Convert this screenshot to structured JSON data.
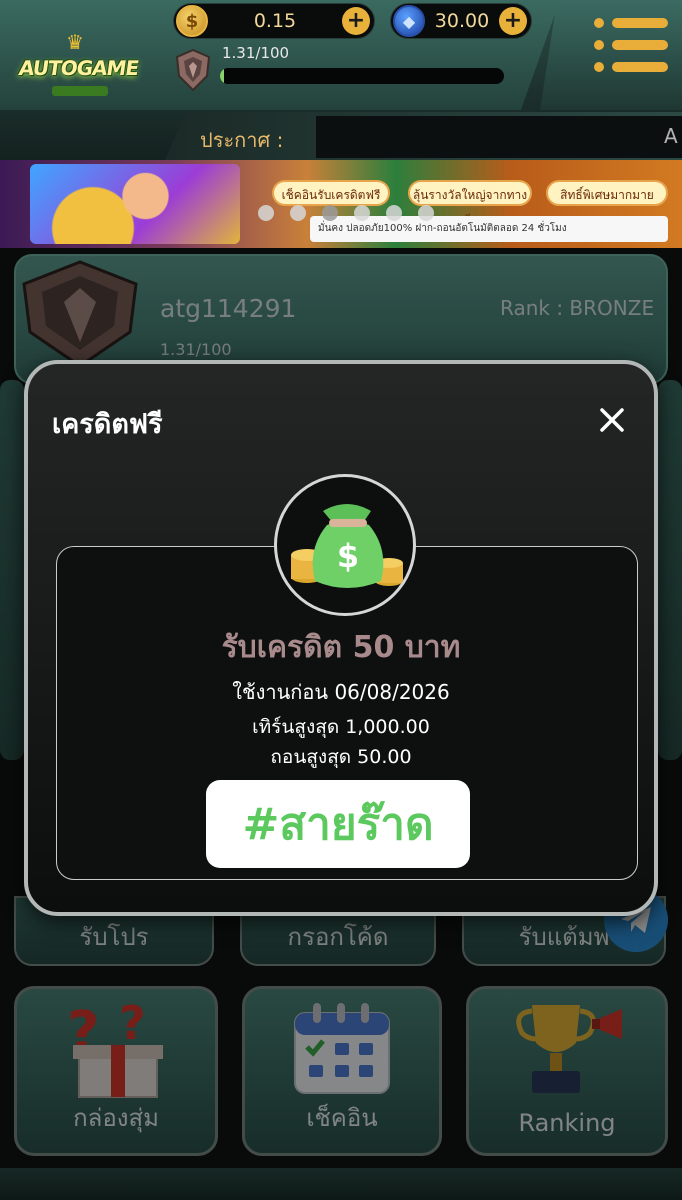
{
  "header": {
    "logo_text": "AUTOGAME",
    "coins": "0.15",
    "gems": "30.00",
    "level_progress": "1.31/100",
    "level_fraction": 0.0131,
    "announcement_label": "ประกาศ :",
    "announcement_tail": "A"
  },
  "banner": {
    "tags": [
      "เช็คอินรับเครดิตฟรีทุกวัน",
      "ลุ้นรางวัลใหญ่จากทางเว็บ",
      "สิทธิ์พิเศษมากมาย"
    ],
    "strip_text": "มั่นคง ปลอดภัย100% ฝาก-ถอนอัตโนมัติตลอด 24 ชั่วโมง",
    "dot_count": 6,
    "active_dot": 2
  },
  "profile": {
    "username": "atg114291",
    "rank": "Rank : BRONZE",
    "progress": "1.31/100"
  },
  "actions": {
    "promo": "รับโปร",
    "code": "กรอกโค้ด",
    "invite": "รับแต้มพ"
  },
  "tiles": {
    "random_box": "กล่องสุ่ม",
    "checkin": "เช็คอิน",
    "ranking": "Ranking"
  },
  "modal": {
    "title": "เครดิตฟรี",
    "reward_title": "รับเครดิต 50 บาท",
    "expire": "ใช้งานก่อน 06/08/2026",
    "max_turnover": "เทิร์นสูงสุด 1,000.00",
    "max_withdraw": "ถอนสูงสุด 50.00",
    "hashtag": "#สายร๊าด"
  },
  "colors": {
    "accent_gold": "#e9ad3a",
    "teal": "#3c6f66",
    "reward_title": "#a88a8c",
    "hashtag_green": "#5cc95e"
  },
  "icons": {
    "coin": "coin-icon",
    "gem": "gem-icon",
    "menu": "hamburger-menu-icon",
    "close": "close-icon",
    "money_bag": "money-bag-icon",
    "telegram": "telegram-icon"
  }
}
